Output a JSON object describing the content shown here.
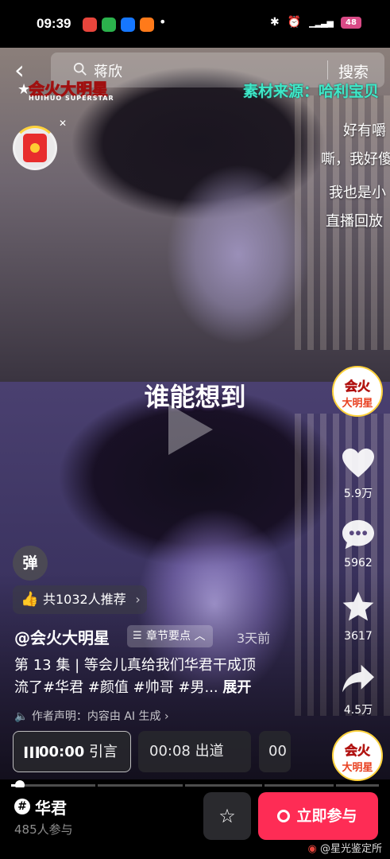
{
  "status_bar": {
    "time": "09:39",
    "app_icons": [
      "weibo-icon",
      "wechat-icon",
      "alipay-icon",
      "taobao-icon"
    ],
    "notification_dot": "•",
    "indicators": [
      "bluetooth-icon",
      "alarm-icon",
      "signal-icon"
    ],
    "battery_label": "48"
  },
  "search": {
    "back_label": "‹",
    "query": "蒋欣",
    "button_label": "搜索"
  },
  "video": {
    "logo_zh": "会火大明星",
    "logo_en": "HUIHUO SUPERSTAR",
    "source_text": "素材来源：哈利宝贝",
    "caption": "谁能想到",
    "danmaku": [
      "好有嚼",
      "嘶，我好傻",
      "我也是小",
      "直播回放"
    ]
  },
  "actions": {
    "avatar_line1": "会火",
    "avatar_line2": "大明星",
    "like_count": "5.9万",
    "comment_count": "5962",
    "favorite_count": "3617",
    "share_count": "4.5万"
  },
  "info": {
    "danmu_toggle": "弹",
    "recommend": "共1032人推荐",
    "recommend_chevron": "›",
    "author": "@会火大明星",
    "chapters_label": "章节要点",
    "time_ago": "3天前",
    "desc_line1": "第 13 集 | 等会儿真给我们华君干成顶",
    "desc_line2": "流了#华君 #颜值 #帅哥 #男...",
    "desc_more": "展开",
    "ai_notice": "作者声明：内容由 AI 生成 ›"
  },
  "chapters": [
    {
      "time": "00:00",
      "title": "引言"
    },
    {
      "time": "00:08",
      "title": "出道"
    },
    {
      "time": "00",
      "title": ""
    }
  ],
  "progress": {
    "fraction": 0.02
  },
  "bottom": {
    "topic_hash": "#",
    "topic_name": "华君",
    "topic_count": "485人参与",
    "join_label": "立即参与",
    "fav_icon": "☆",
    "watermark": "@星光鉴定所"
  },
  "colors": {
    "accent_red": "#fe2c55",
    "source_text": "#3ee8c8",
    "logo_yellow": "#ffd23c"
  }
}
